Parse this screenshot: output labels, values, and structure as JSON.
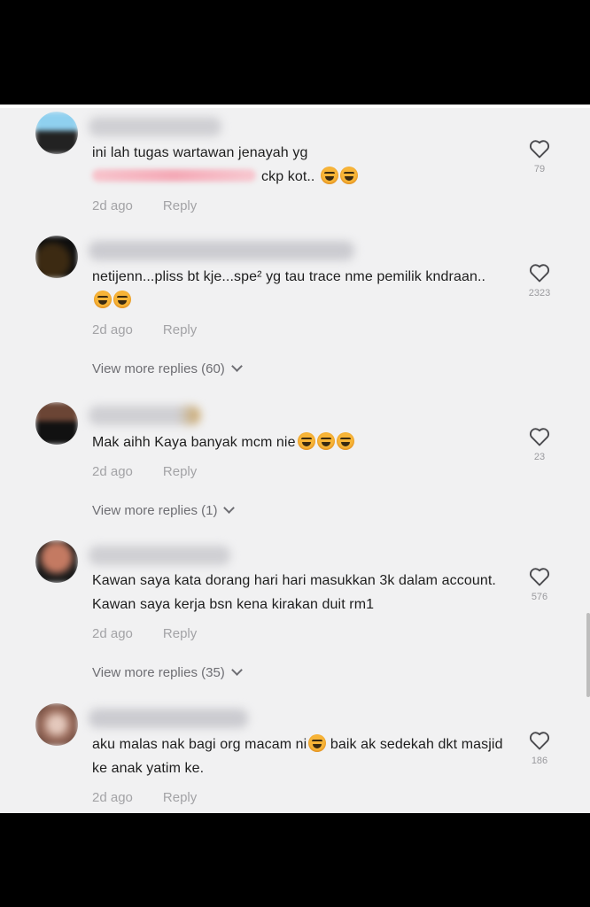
{
  "comments": [
    {
      "text_before": "ini lah tugas wartawan jenayah yg",
      "text_after": "ckp kot..",
      "time": "2d ago",
      "reply_label": "Reply",
      "like_count": "79",
      "avatar_colors": [
        "#8fd0ef",
        "#222222"
      ]
    },
    {
      "text": "netijenn...pliss bt kje...spe² yg tau trace nme pemilik kndraan..",
      "time": "2d ago",
      "reply_label": "Reply",
      "like_count": "2323",
      "view_more": "View more replies (60)",
      "avatar_colors": [
        "#2a2a2a",
        "#3c2a12"
      ]
    },
    {
      "text": "Mak aihh Kaya banyak mcm nie",
      "time": "2d ago",
      "reply_label": "Reply",
      "like_count": "23",
      "view_more": "View more replies (1)",
      "avatar_colors": [
        "#5b3a2c",
        "#111111"
      ]
    },
    {
      "text": "Kawan saya kata dorang hari hari masukkan 3k dalam account. Kawan saya kerja bsn kena kirakan duit rm1",
      "time": "2d ago",
      "reply_label": "Reply",
      "like_count": "576",
      "view_more": "View more replies (35)",
      "avatar_colors": [
        "#c47a62",
        "#1a1a1a"
      ]
    },
    {
      "text_before": "aku malas nak bagi org macam ni",
      "text_after": "baik ak sedekah dkt masjid ke anak yatim ke.",
      "time": "2d ago",
      "reply_label": "Reply",
      "like_count": "186",
      "avatar_colors": [
        "#9a6c5c",
        "#e4c8bc"
      ]
    }
  ],
  "icons": {
    "like": "heart-outline-icon",
    "expand": "chevron-down-icon",
    "emoji": "face-emoji-icon"
  }
}
